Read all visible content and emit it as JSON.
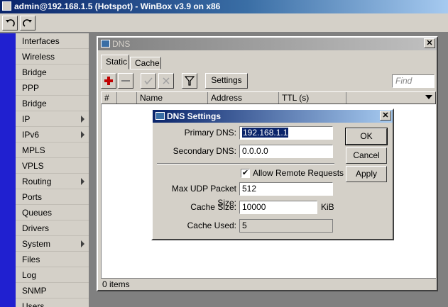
{
  "window_title": "admin@192.168.1.5 (Hotspot) - WinBox v3.9 on x86",
  "toolbar": {
    "undo_icon": "undo-icon",
    "redo_icon": "redo-icon"
  },
  "sidebar": {
    "items": [
      {
        "label": "Interfaces",
        "submenu": false
      },
      {
        "label": "Wireless",
        "submenu": false
      },
      {
        "label": "Bridge",
        "submenu": false
      },
      {
        "label": "PPP",
        "submenu": false
      },
      {
        "label": "Bridge",
        "submenu": false
      },
      {
        "label": "IP",
        "submenu": true
      },
      {
        "label": "IPv6",
        "submenu": true
      },
      {
        "label": "MPLS",
        "submenu": false
      },
      {
        "label": "VPLS",
        "submenu": false
      },
      {
        "label": "Routing",
        "submenu": true
      },
      {
        "label": "Ports",
        "submenu": false
      },
      {
        "label": "Queues",
        "submenu": false
      },
      {
        "label": "Drivers",
        "submenu": false
      },
      {
        "label": "System",
        "submenu": true
      },
      {
        "label": "Files",
        "submenu": false
      },
      {
        "label": "Log",
        "submenu": false
      },
      {
        "label": "SNMP",
        "submenu": false
      },
      {
        "label": "Users",
        "submenu": false
      }
    ]
  },
  "dns_window": {
    "title": "DNS",
    "close_label": "✕",
    "tabs": [
      "Static",
      "Cache"
    ],
    "settings_label": "Settings",
    "find_placeholder": "Find",
    "columns": [
      "#",
      "",
      "Name",
      "Address",
      "TTL (s)"
    ],
    "status": "0 items"
  },
  "dns_settings": {
    "title": "DNS Settings",
    "close_label": "✕",
    "primary_dns_label": "Primary DNS:",
    "primary_dns_value": "192.168.1.1",
    "secondary_dns_label": "Secondary DNS:",
    "secondary_dns_value": "0.0.0.0",
    "allow_remote_label": "Allow Remote Requests",
    "allow_remote_checked": true,
    "max_udp_label": "Max UDP Packet Size:",
    "max_udp_value": "512",
    "cache_size_label": "Cache Size:",
    "cache_size_value": "10000",
    "cache_size_unit": "KiB",
    "cache_used_label": "Cache Used:",
    "cache_used_value": "5",
    "buttons": {
      "ok": "OK",
      "cancel": "Cancel",
      "apply": "Apply"
    }
  }
}
